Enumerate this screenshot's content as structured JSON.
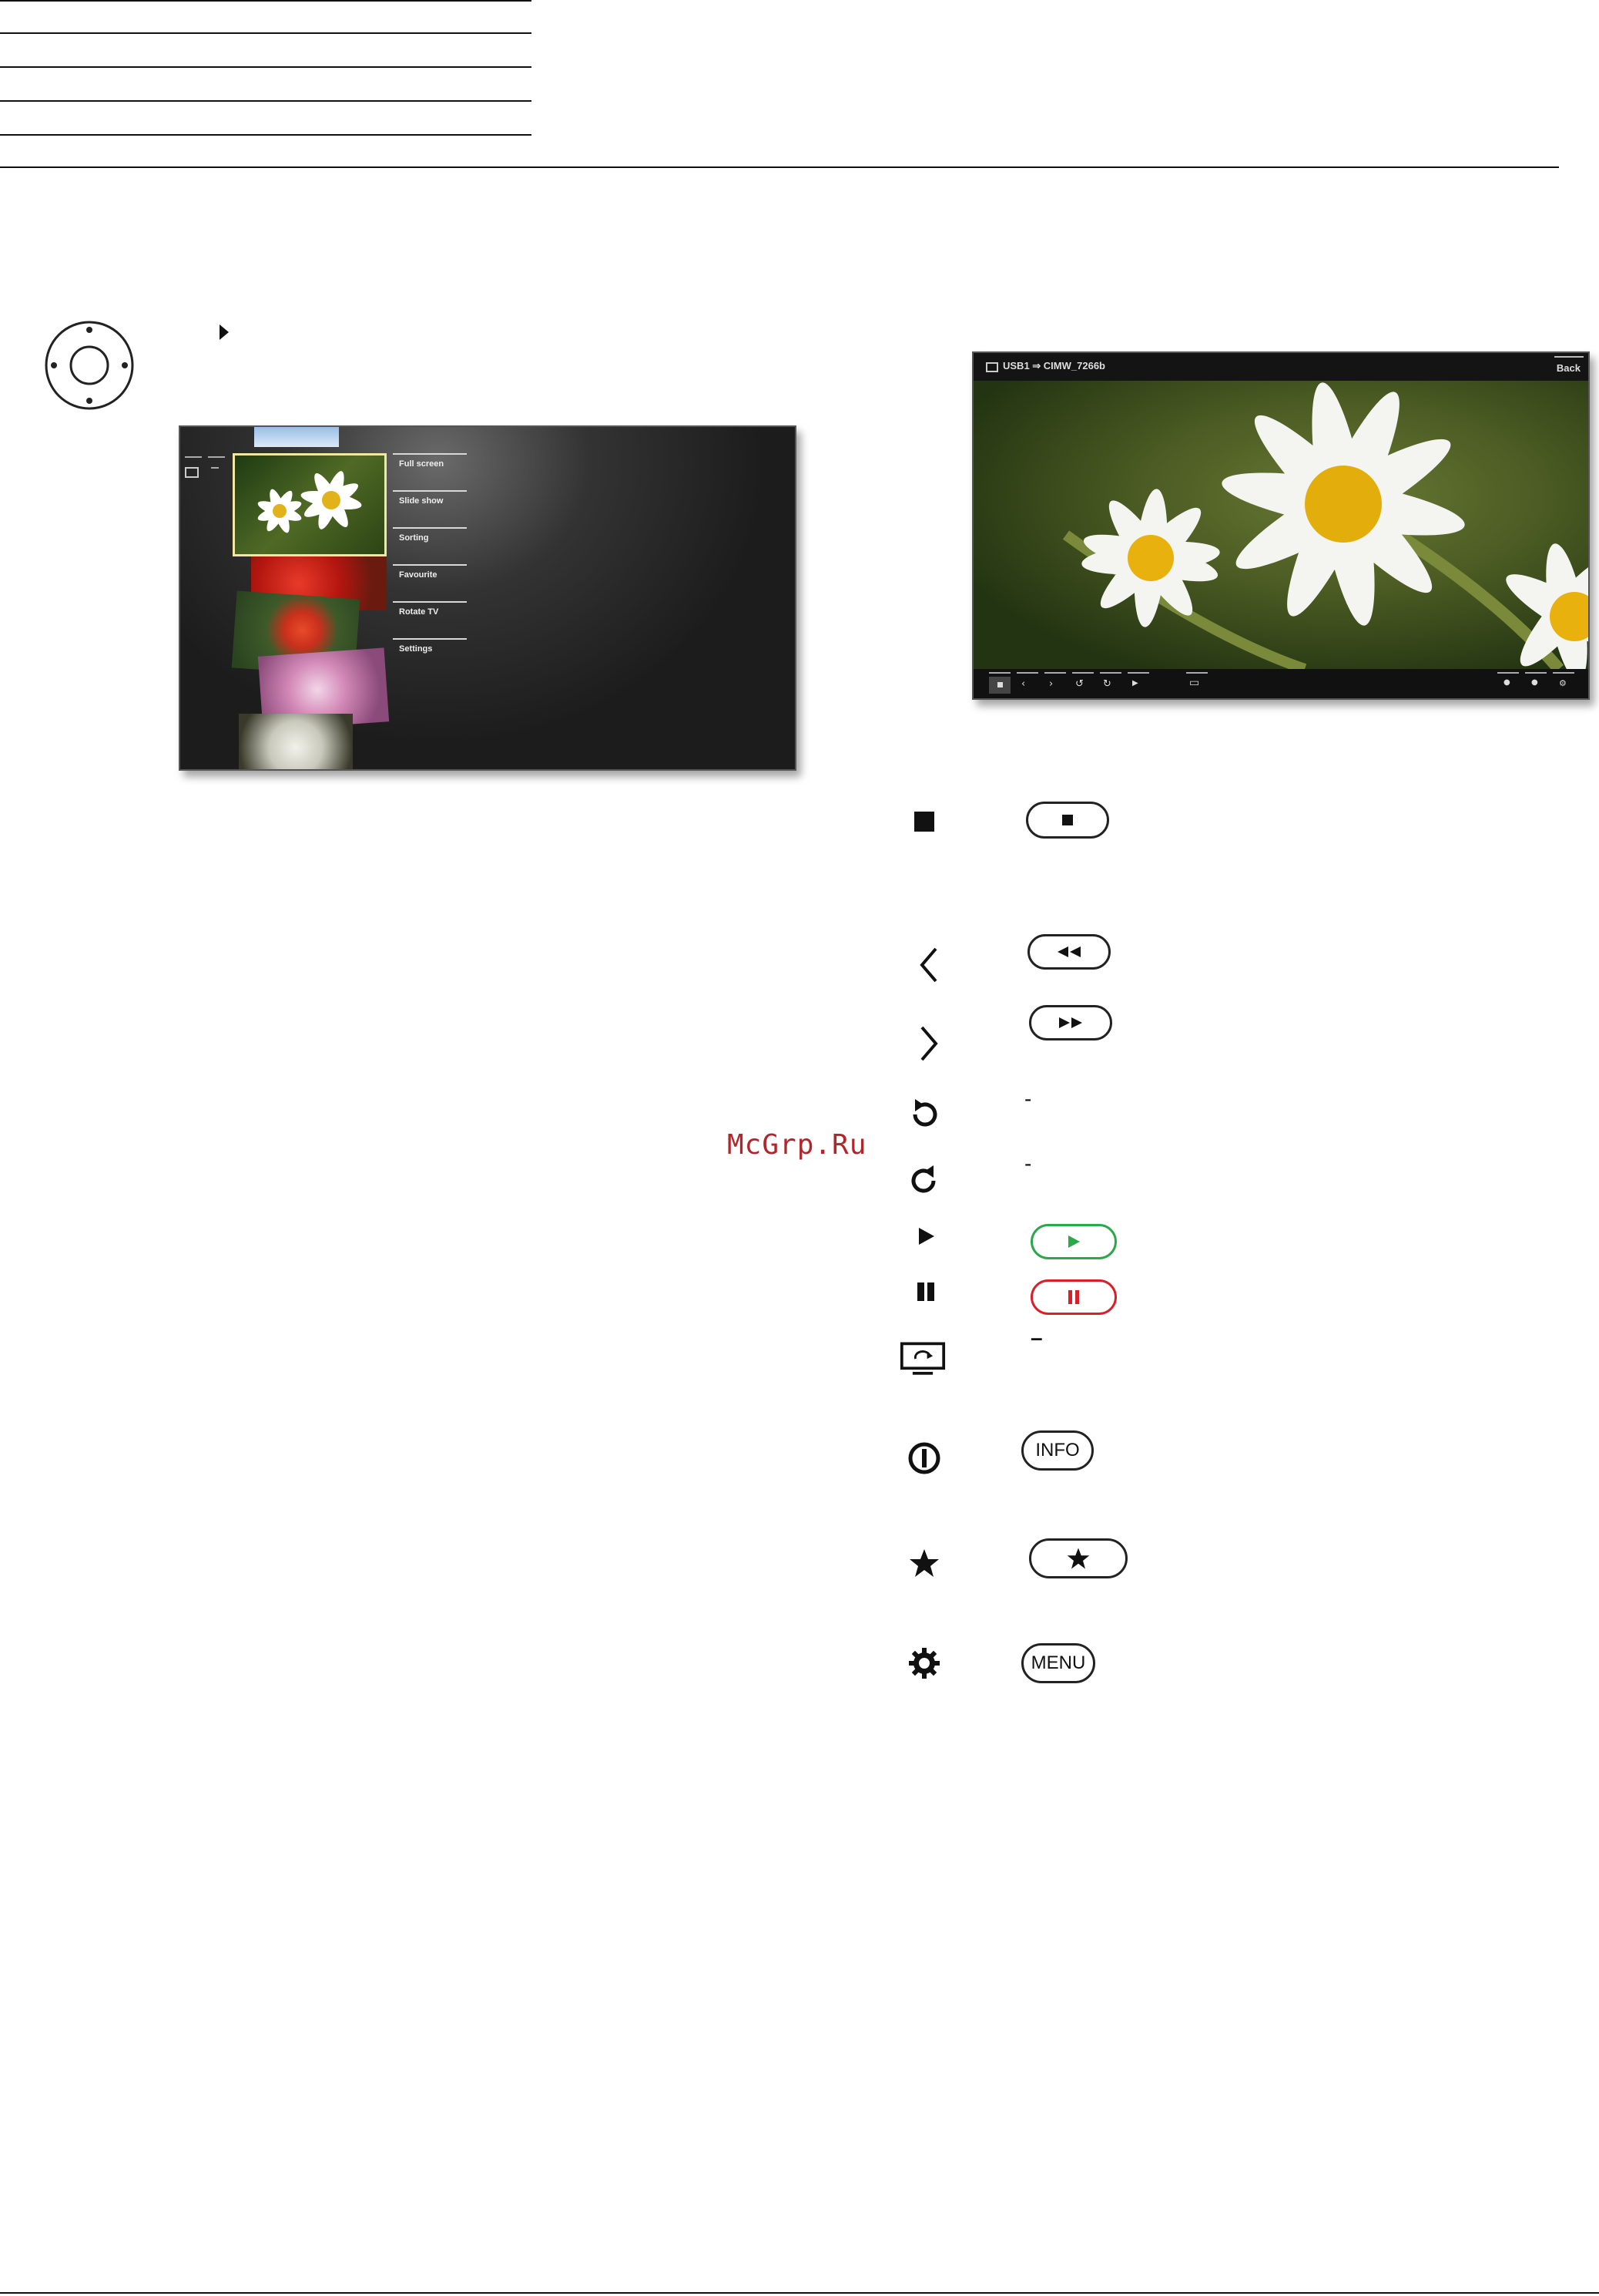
{
  "header_rules": {
    "count": 5
  },
  "watermark": "McGrp.Ru",
  "media_browser": {
    "menu_items": [
      "Full screen",
      "Slide show",
      "Sorting",
      "Favourite",
      "Rotate TV",
      "Settings"
    ]
  },
  "viewer": {
    "source_path": "USB1 ⇒ CIMW_7266b",
    "back_label": "Back"
  },
  "legend": [
    {
      "icon": "stop-icon",
      "button": "stop-button",
      "button_label": "■",
      "dash": ""
    },
    {
      "icon": "previous-icon",
      "button": "rewind-button",
      "button_label": "◀◀",
      "dash": ""
    },
    {
      "icon": "next-icon",
      "button": "fast-forward-button",
      "button_label": "▶▶",
      "dash": ""
    },
    {
      "icon": "rotate-left-icon",
      "button": "",
      "button_label": "",
      "dash": "-"
    },
    {
      "icon": "rotate-right-icon",
      "button": "",
      "button_label": "",
      "dash": "-"
    },
    {
      "icon": "play-icon",
      "button": "play-button",
      "button_label": "▶",
      "dash": ""
    },
    {
      "icon": "pause-icon",
      "button": "pause-button",
      "button_label": "▌▌",
      "dash": ""
    },
    {
      "icon": "rotate-tv-icon",
      "button": "",
      "button_label": "",
      "dash": "–"
    },
    {
      "icon": "info-icon",
      "button": "info-button",
      "button_label": "INFO",
      "dash": ""
    },
    {
      "icon": "favourite-star-icon",
      "button": "star-button",
      "button_label": "★",
      "dash": ""
    },
    {
      "icon": "settings-gear-icon",
      "button": "menu-button",
      "button_label": "MENU",
      "dash": ""
    }
  ],
  "colors": {
    "play": "#2aa84a",
    "pause": "#d8202a",
    "accent_frame": "#f2e7a0"
  }
}
